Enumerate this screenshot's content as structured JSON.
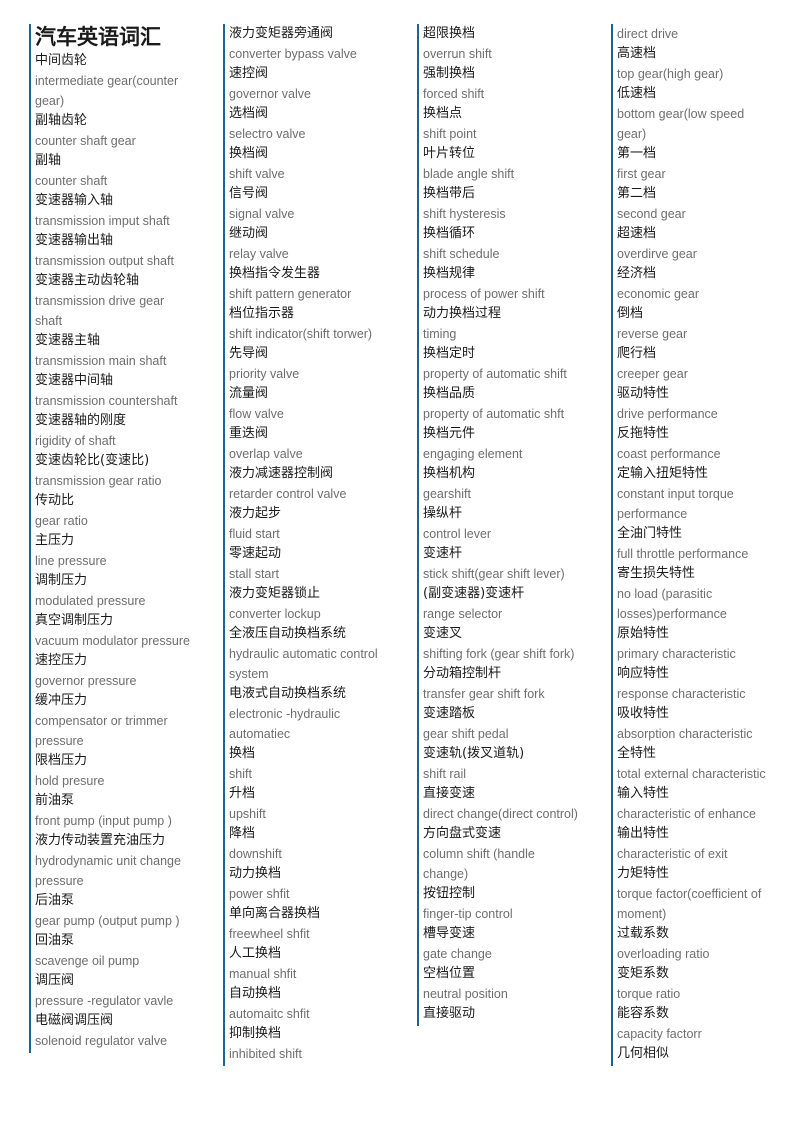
{
  "page": {
    "title": "汽车英语词汇",
    "accent_color": "#1a6496",
    "chinese_color": "#1a1a1a",
    "english_color": "#6e6e6e",
    "background_color": "#ffffff"
  },
  "columns": [
    {
      "id": "column-1",
      "has_title": true,
      "entries": [
        {
          "zh": "中间齿轮",
          "en": "intermediate gear(counter gear)"
        },
        {
          "zh": "副轴齿轮",
          "en": "counter shaft gear"
        },
        {
          "zh": "副轴",
          "en": "counter shaft"
        },
        {
          "zh": "变速器输入轴",
          "en": "transmission imput shaft"
        },
        {
          "zh": "变速器输出轴",
          "en": "transmission output shaft"
        },
        {
          "zh": "变速器主动齿轮轴",
          "en": "transmission drive gear shaft"
        },
        {
          "zh": "变速器主轴",
          "en": "transmission main shaft"
        },
        {
          "zh": "变速器中间轴",
          "en": "transmission countershaft"
        },
        {
          "zh": "变速器轴的刚度",
          "en": "rigidity of shaft"
        },
        {
          "zh": "变速齿轮比(变速比)",
          "en": "transmission gear ratio"
        },
        {
          "zh": "传动比",
          "en": "gear ratio"
        },
        {
          "zh": "主压力",
          "en": "line pressure"
        },
        {
          "zh": "调制压力",
          "en": "modulated pressure"
        },
        {
          "zh": "真空调制压力",
          "en": "vacuum modulator pressure"
        },
        {
          "zh": "速控压力",
          "en": "governor pressure"
        },
        {
          "zh": "缓冲压力",
          "en": "compensator or trimmer pressure"
        },
        {
          "zh": "限档压力",
          "en": "hold presure"
        },
        {
          "zh": "前油泵",
          "en": "front pump (input pump )"
        },
        {
          "zh": "液力传动装置充油压力",
          "en": "hydrodynamic unit change pressure"
        },
        {
          "zh": "后油泵",
          "en": "gear pump (output pump )"
        },
        {
          "zh": "回油泵",
          "en": "scavenge oil pump"
        },
        {
          "zh": "调压阀",
          "en": "pressure -regulator vavle"
        },
        {
          "zh": "电磁阀调压阀",
          "en": "solenoid regulator valve"
        }
      ]
    },
    {
      "id": "column-2",
      "has_title": false,
      "entries": [
        {
          "zh": "液力变矩器旁通阀",
          "en": "converter bypass valve"
        },
        {
          "zh": "速控阀",
          "en": "governor valve"
        },
        {
          "zh": "选档阀",
          "en": "selectro valve"
        },
        {
          "zh": "换档阀",
          "en": "shift valve"
        },
        {
          "zh": "信号阀",
          "en": "signal valve"
        },
        {
          "zh": "继动阀",
          "en": "relay valve"
        },
        {
          "zh": "换档指令发生器",
          "en": "shift pattern generator"
        },
        {
          "zh": "档位指示器",
          "en": "shift indicator(shift torwer)"
        },
        {
          "zh": "先导阀",
          "en": "priority valve"
        },
        {
          "zh": "流量阀",
          "en": "flow valve"
        },
        {
          "zh": "重迭阀",
          "en": "overlap valve"
        },
        {
          "zh": "液力减速器控制阀",
          "en": "retarder control valve"
        },
        {
          "zh": "液力起步",
          "en": "fluid start"
        },
        {
          "zh": "零速起动",
          "en": "stall start"
        },
        {
          "zh": "液力变矩器锁止",
          "en": "converter lockup"
        },
        {
          "zh": "全液压自动换档系统",
          "en": "hydraulic automatic control system"
        },
        {
          "zh": "电液式自动换档系统",
          "en": "electronic -hydraulic automatiec"
        },
        {
          "zh": "换档",
          "en": "shift"
        },
        {
          "zh": "升档",
          "en": "upshift"
        },
        {
          "zh": "降档",
          "en": "downshift"
        },
        {
          "zh": "动力换档",
          "en": "power shfit"
        },
        {
          "zh": "单向离合器换档",
          "en": "freewheel shfit"
        },
        {
          "zh": "人工换档",
          "en": "manual shfit"
        },
        {
          "zh": "自动换档",
          "en": "automaitc shfit"
        },
        {
          "zh": "抑制换档",
          "en": "inhibited shift"
        }
      ]
    },
    {
      "id": "column-3",
      "has_title": false,
      "entries": [
        {
          "zh": "超限换档",
          "en": "overrun shift"
        },
        {
          "zh": "强制换档",
          "en": "forced shift"
        },
        {
          "zh": "换档点",
          "en": "shift point"
        },
        {
          "zh": "叶片转位",
          "en": "blade angle shift"
        },
        {
          "zh": "换档带后",
          "en": "shift hysteresis"
        },
        {
          "zh": "换档循环",
          "en": "shift schedule"
        },
        {
          "zh": "换档规律",
          "en": "process of power shift"
        },
        {
          "zh": "动力换档过程",
          "en": "timing"
        },
        {
          "zh": "换档定时",
          "en": "property of automatic shift"
        },
        {
          "zh": "换档品质",
          "en": "property of automatic shft"
        },
        {
          "zh": "换档元件",
          "en": "engaging element"
        },
        {
          "zh": "换档机构",
          "en": "gearshift"
        },
        {
          "zh": "操纵杆",
          "en": "control lever"
        },
        {
          "zh": "变速杆",
          "en": "stick shift(gear shift lever)"
        },
        {
          "zh": "(副变速器)变速杆",
          "en": "range selector"
        },
        {
          "zh": "变速叉",
          "en": "shifting fork (gear shift fork)"
        },
        {
          "zh": "分动箱控制杆",
          "en": "transfer gear shift fork"
        },
        {
          "zh": "变速踏板",
          "en": "gear shift pedal"
        },
        {
          "zh": "变速轨(拨叉道轨)",
          "en": "shift rail"
        },
        {
          "zh": "直接变速",
          "en": "direct change(direct control)"
        },
        {
          "zh": "方向盘式变速",
          "en": "column shift (handle change)"
        },
        {
          "zh": "按钮控制",
          "en": "finger-tip control"
        },
        {
          "zh": "槽导变速",
          "en": "gate change"
        },
        {
          "zh": "空档位置",
          "en": "neutral position"
        },
        {
          "zh": "直接驱动",
          "en": ""
        }
      ]
    },
    {
      "id": "column-4",
      "has_title": false,
      "entries": [
        {
          "zh": "",
          "en": "direct drive"
        },
        {
          "zh": "高速档",
          "en": "top gear(high gear)"
        },
        {
          "zh": "低速档",
          "en": "bottom gear(low speed gear)"
        },
        {
          "zh": "第一档",
          "en": "first gear"
        },
        {
          "zh": "第二档",
          "en": "second gear"
        },
        {
          "zh": "超速档",
          "en": "overdirve gear"
        },
        {
          "zh": "经济档",
          "en": "economic gear"
        },
        {
          "zh": "倒档",
          "en": "reverse gear"
        },
        {
          "zh": "爬行档",
          "en": "creeper gear"
        },
        {
          "zh": "驱动特性",
          "en": "drive performance"
        },
        {
          "zh": "反拖特性",
          "en": "coast performance"
        },
        {
          "zh": "定输入扭矩特性",
          "en": "constant input torque performance"
        },
        {
          "zh": "全油门特性",
          "en": "full throttle performance"
        },
        {
          "zh": "寄生损失特性",
          "en": "no load (parasitic losses)performance"
        },
        {
          "zh": "原始特性",
          "en": "primary characteristic"
        },
        {
          "zh": "响应特性",
          "en": "response characteristic"
        },
        {
          "zh": "吸收特性",
          "en": "absorption characteristic"
        },
        {
          "zh": "全特性",
          "en": "total external characteristic"
        },
        {
          "zh": "输入特性",
          "en": "characteristic of enhance"
        },
        {
          "zh": "输出特性",
          "en": "characteristic of exit"
        },
        {
          "zh": "力矩特性",
          "en": "torque factor(coefficient of moment)"
        },
        {
          "zh": "过载系数",
          "en": "overloading ratio"
        },
        {
          "zh": "变矩系数",
          "en": "torque ratio"
        },
        {
          "zh": "能容系数",
          "en": "capacity factorr"
        },
        {
          "zh": "几何相似",
          "en": ""
        }
      ]
    }
  ]
}
